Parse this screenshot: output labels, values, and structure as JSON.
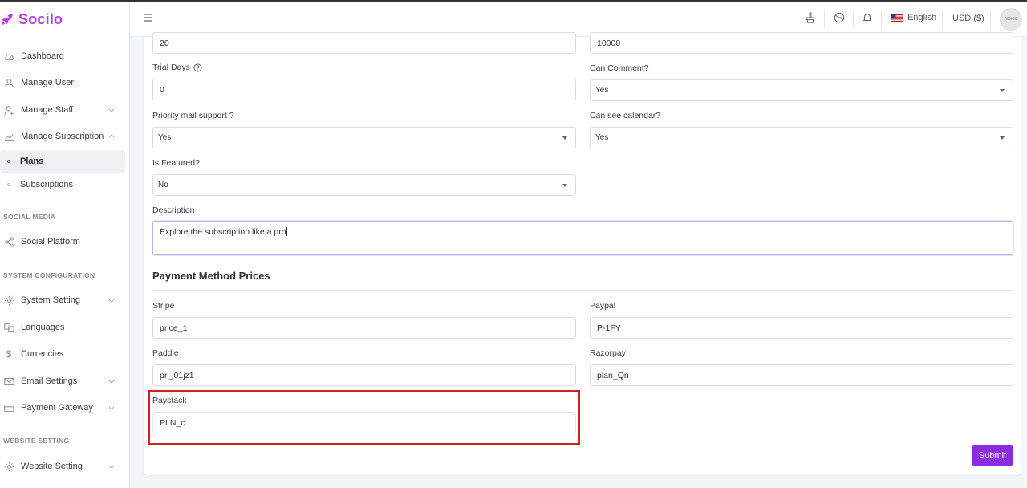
{
  "brand": {
    "name": "Socilo",
    "color": "#b43ee0"
  },
  "sidebar": {
    "items": [
      {
        "label": "Dashboard",
        "icon": "dashboard-icon"
      },
      {
        "label": "Manage User",
        "icon": "user-icon"
      },
      {
        "label": "Manage Staff",
        "icon": "staff-icon"
      },
      {
        "label": "Manage Subscription",
        "icon": "chart-icon"
      },
      {
        "label": "Plans"
      },
      {
        "label": "Subscriptions"
      },
      {
        "label": "Social Platform",
        "icon": "share-icon"
      },
      {
        "label": "System Setting",
        "icon": "gear-icon"
      },
      {
        "label": "Languages",
        "icon": "language-icon"
      },
      {
        "label": "Currencies",
        "icon": "dollar-icon"
      },
      {
        "label": "Email Settings",
        "icon": "mail-icon"
      },
      {
        "label": "Payment Gateway",
        "icon": "card-icon"
      },
      {
        "label": "Website Setting",
        "icon": "gear-icon"
      }
    ],
    "sections": {
      "social_media": "SOCIAL MEDIA",
      "system_configuration": "SYSTEM CONFIGURATION",
      "website_setting": "WEBSITE SETTING"
    }
  },
  "header": {
    "language": "English",
    "currency": "USD ($)",
    "avatar_text": "NX+98"
  },
  "form": {
    "top_left_value": "20",
    "top_right_value": "10000",
    "trial_days": {
      "label": "Trial Days",
      "value": "0"
    },
    "can_comment": {
      "label": "Can Comment?",
      "value": "Yes"
    },
    "priority_mail": {
      "label": "Priority mail support ?",
      "value": "Yes"
    },
    "can_see_calendar": {
      "label": "Can see calendar?",
      "value": "Yes"
    },
    "is_featured": {
      "label": "Is Featured?",
      "value": "No"
    },
    "description": {
      "label": "Description",
      "value": "Explore the subscription like a pro"
    },
    "payment_section_title": "Payment Method Prices",
    "stripe": {
      "label": "Stripe",
      "value": "price_1"
    },
    "paypal": {
      "label": "Paypal",
      "value": "P-1FY"
    },
    "paddle": {
      "label": "Paddle",
      "value": "pri_01jz1"
    },
    "razorpay": {
      "label": "Razorpay",
      "value": "plan_Qn"
    },
    "paystack": {
      "label": "Paystack",
      "value": "PLN_c"
    },
    "submit_label": "Submit"
  },
  "colors": {
    "accent": "#8b2ce0",
    "highlight": "#d32020"
  }
}
